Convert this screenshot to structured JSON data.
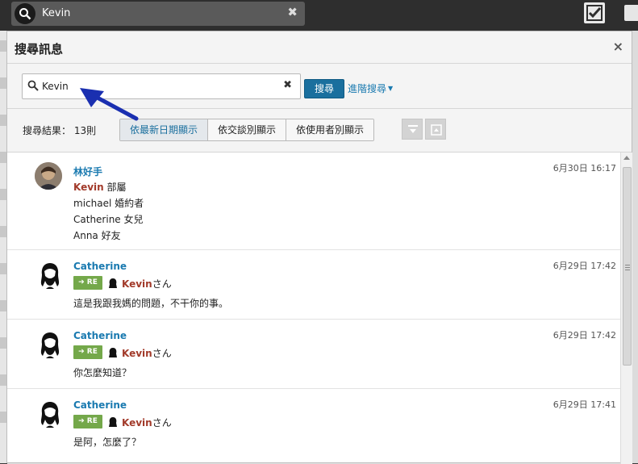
{
  "topbar": {
    "search_value": "Kevin",
    "clear_icon": "x-icon",
    "check_icon": "checkbox-icon",
    "folder_icon": "folder-icon"
  },
  "dialog": {
    "title": "搜尋訊息",
    "close_label": "×",
    "search": {
      "value": "Kevin",
      "clear_label": "✖",
      "button_label": "搜尋",
      "advanced_label": "進階搜尋"
    },
    "result_count": "搜尋結果： 13則",
    "tabs": [
      {
        "label": "依最新日期顯示",
        "active": true
      },
      {
        "label": "依交談別顯示",
        "active": false
      },
      {
        "label": "依使用者別顯示",
        "active": false
      }
    ]
  },
  "messages": [
    {
      "sender": "林好手",
      "time": "6月30日 16:17",
      "lines": [
        {
          "name": "Kevin",
          "text": " 部屬"
        },
        {
          "name": "",
          "text": "michael 婚約者"
        },
        {
          "name": "",
          "text": "Catherine 女兒"
        },
        {
          "name": "",
          "text": "Anna 好友"
        }
      ]
    },
    {
      "sender": "Catherine",
      "time": "6月29日 17:42",
      "re_label": "RE",
      "re_name": "Kevin",
      "re_suffix": "さん",
      "text": "這是我跟我媽的問題，不干你的事。"
    },
    {
      "sender": "Catherine",
      "time": "6月29日 17:42",
      "re_label": "RE",
      "re_name": "Kevin",
      "re_suffix": "さん",
      "text": "你怎麼知道？"
    },
    {
      "sender": "Catherine",
      "time": "6月29日 17:41",
      "re_label": "RE",
      "re_name": "Kevin",
      "re_suffix": "さん",
      "text": "是阿，怎麼了？"
    }
  ],
  "colors": {
    "accent": "#1a6f9e",
    "link": "#1a7ab0",
    "name_red": "#a23a2a",
    "re_green": "#74a84a",
    "annotation_arrow": "#1a2fb0"
  }
}
